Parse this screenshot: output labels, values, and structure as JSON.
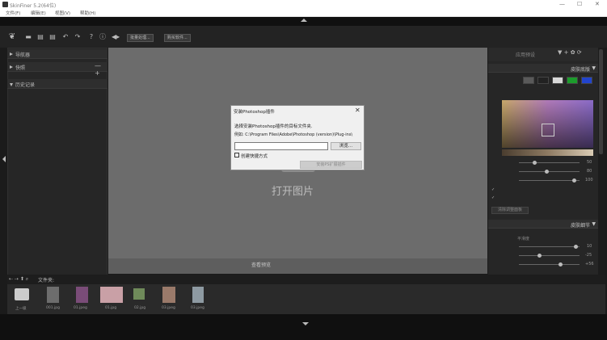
{
  "window": {
    "title": "SkinFiner 5.2(64位)",
    "minimize": "—",
    "maximize": "☐",
    "close": "✕"
  },
  "menu": [
    "文件(F)",
    "编辑(E)",
    "视图(V)",
    "帮助(H)"
  ],
  "toolbar": {
    "batch_button": "批量处理...",
    "purchase_button": "购买软件..."
  },
  "left_panel": {
    "navigator": "导航器",
    "snapshot": "快照",
    "snapshot_controls": "— +",
    "history": "历史记录"
  },
  "canvas": {
    "open_image": "打开图片",
    "preview": "查看预览"
  },
  "right_panel": {
    "preset_label": "应用预设",
    "preset_controls": "▼ + ✿ ⟳",
    "skin_tone": "皮肤底版",
    "skin_tone_toggle": "▼",
    "skin_detail": "皮肤细节",
    "skin_detail_toggle": "▼",
    "values1": [
      "50",
      "80",
      "100"
    ],
    "values2": [
      "10",
      "-25",
      "+56"
    ],
    "check1": "✓",
    "check2": "✓",
    "reset_button": "清除调整面板",
    "skin_detail_sub": "平滑度",
    "swatch_colors": [
      "#5a5a5a",
      "#222222",
      "#d8d8d8",
      "#1c9c2c",
      "#2244cc"
    ]
  },
  "filebrowser": {
    "nav": "⇠ ⇢ ⬆ ⌕",
    "label": "文件夹:",
    "items": [
      {
        "name": "上一级"
      },
      {
        "name": "001.jpg"
      },
      {
        "name": "01.jpeg"
      },
      {
        "name": "01.jpg"
      },
      {
        "name": "02.jpg"
      },
      {
        "name": "03.jpeg"
      },
      {
        "name": "03.jpeg"
      }
    ]
  },
  "dialog": {
    "title": "安装Photoshop插件",
    "close": "✕",
    "instruction": "选择安装Photoshop插件的目标文件夹.",
    "example": "例如: C:\\Program Files\\Adobe\\Photoshop (version)\\Plug-ins\\",
    "input_value": "",
    "browse_button": "浏览...",
    "shortcut_checkbox_checked": true,
    "shortcut_check_glyph": "✓",
    "shortcut_label": "创建快捷方式",
    "install_button": "安装PS扩展插件"
  }
}
